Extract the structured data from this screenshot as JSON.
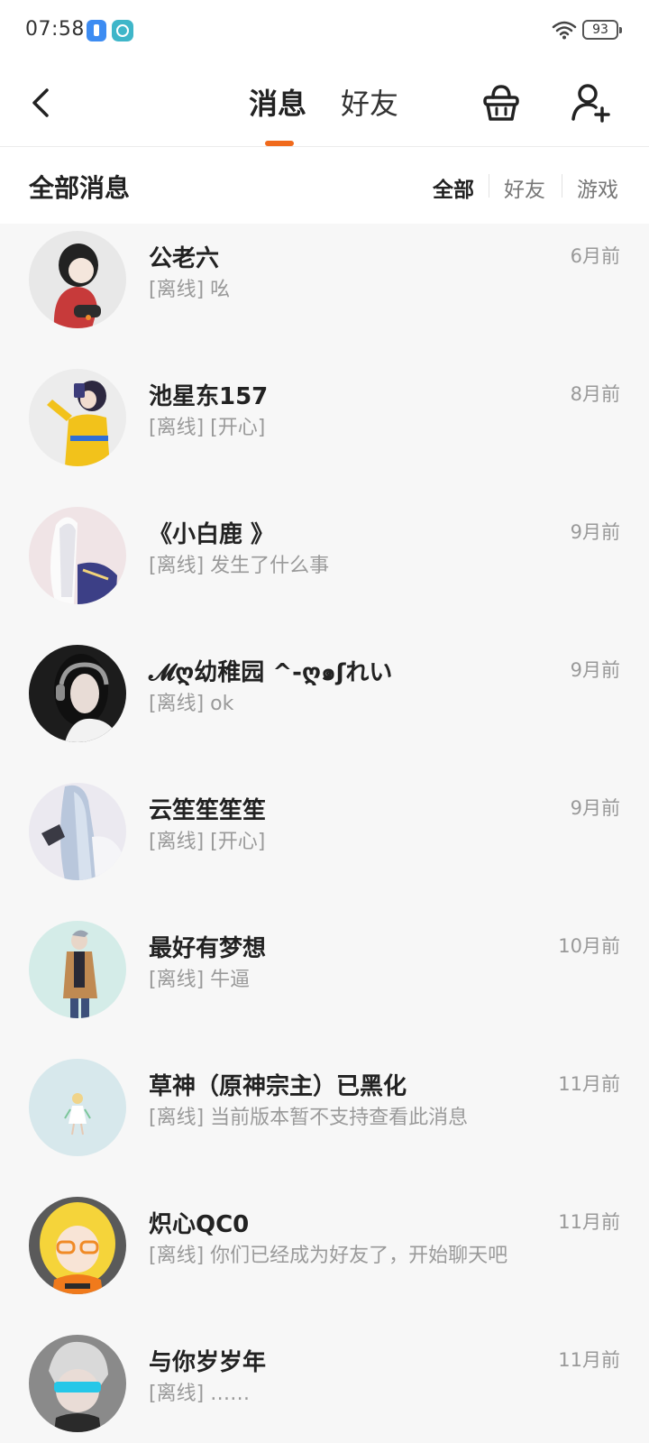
{
  "status_bar": {
    "time": "07:58",
    "battery": "93"
  },
  "header": {
    "tabs": [
      {
        "label": "消息",
        "active": true
      },
      {
        "label": "好友",
        "active": false
      }
    ],
    "accent_color": "#f06a1c"
  },
  "filter_bar": {
    "title": "全部消息",
    "options": [
      {
        "label": "全部",
        "active": true
      },
      {
        "label": "好友",
        "active": false
      },
      {
        "label": "游戏",
        "active": false
      }
    ]
  },
  "messages": [
    {
      "name": "公老六",
      "preview": "[离线] 吆",
      "time": "6月前"
    },
    {
      "name": "池星东157",
      "preview": "[离线] [开心]",
      "time": "8月前"
    },
    {
      "name": "《小白鹿 》",
      "preview": "[离线] 发生了什么事",
      "time": "9月前"
    },
    {
      "name": "𝓜ღ幼稚园 ^-ღ๑ʃれい",
      "preview": "[离线] ok",
      "time": "9月前"
    },
    {
      "name": "云笙笙笙笙",
      "preview": "[离线] [开心]",
      "time": "9月前"
    },
    {
      "name": "最好有梦想",
      "preview": "[离线] 牛逼",
      "time": "10月前"
    },
    {
      "name": "草神（原神宗主）已黑化",
      "preview": "[离线] 当前版本暂不支持查看此消息",
      "time": "11月前"
    },
    {
      "name": "炽心QC0",
      "preview": "[离线] 你们已经成为好友了，开始聊天吧",
      "time": "11月前"
    },
    {
      "name": "与你岁岁年",
      "preview": "[离线] ……",
      "time": "11月前"
    }
  ]
}
